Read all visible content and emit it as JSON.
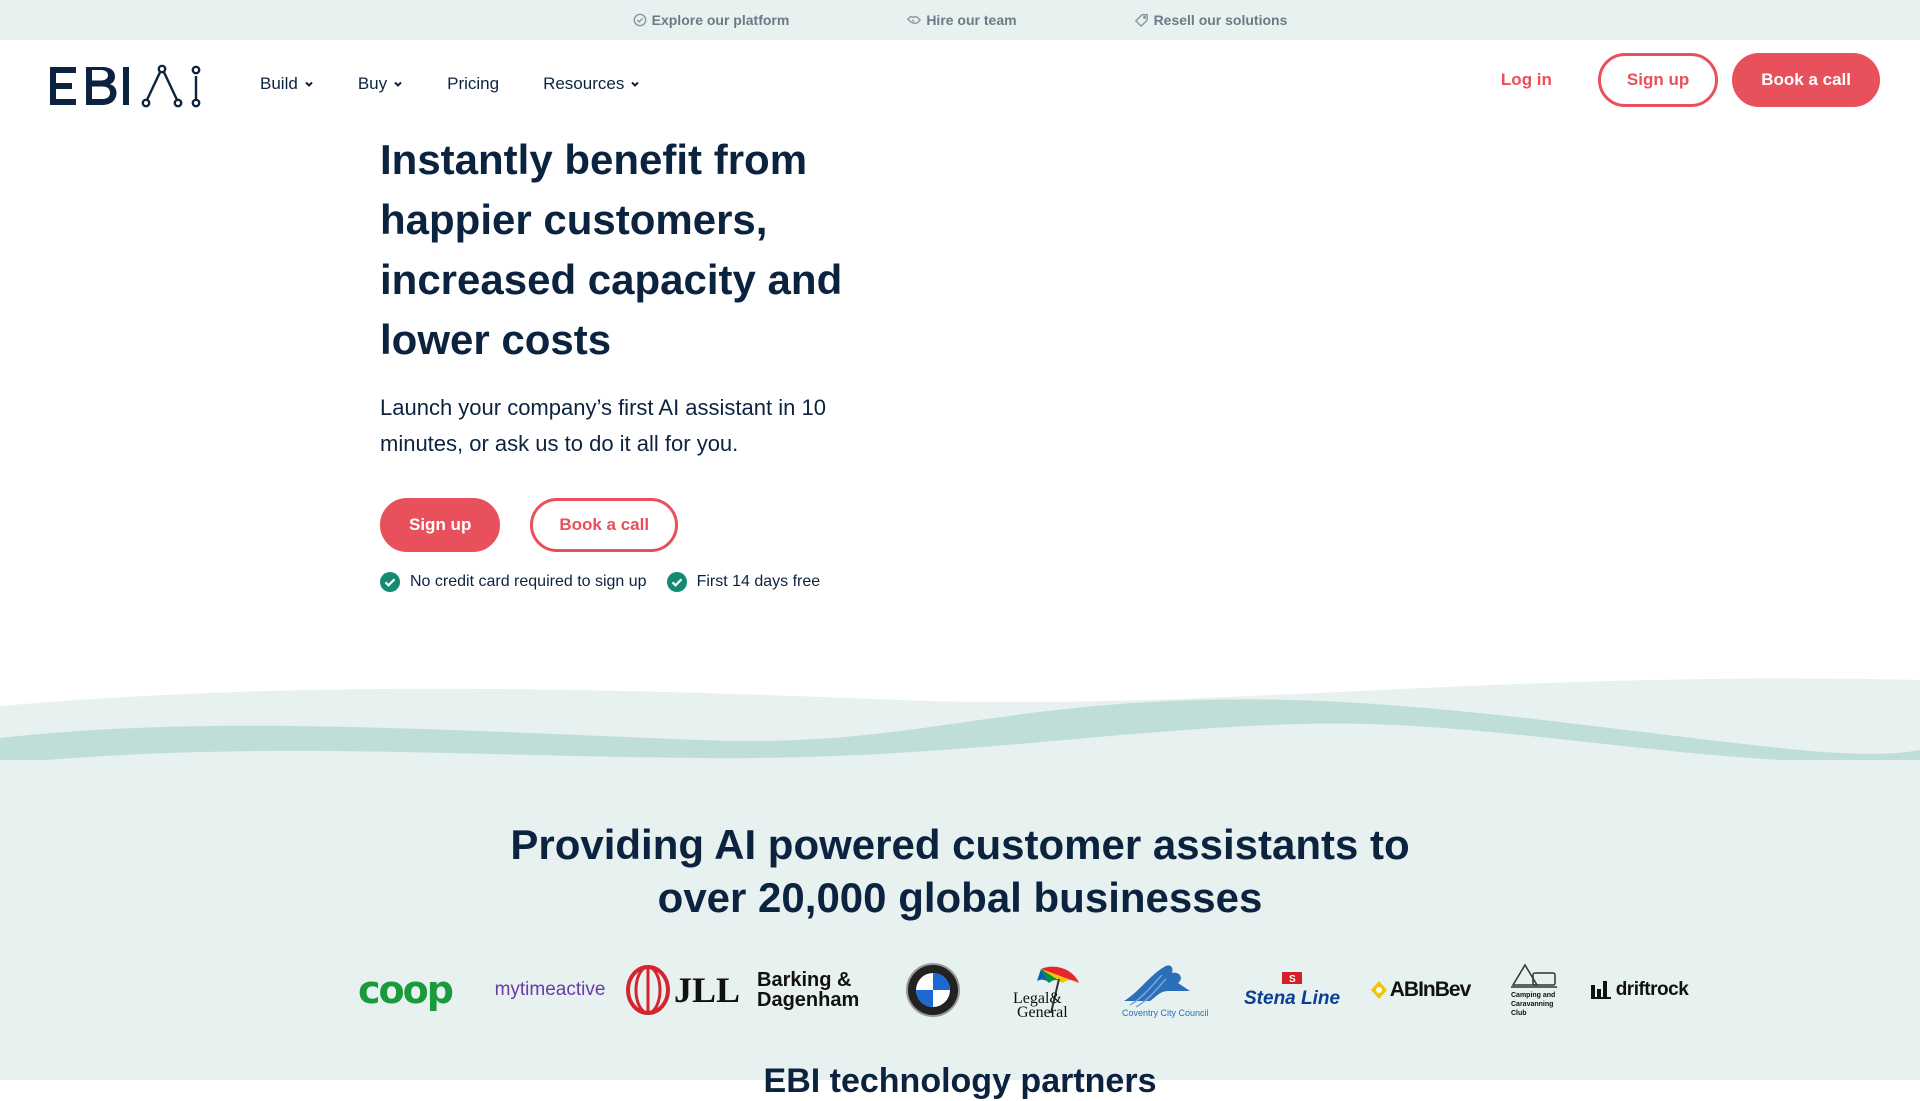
{
  "topbar": {
    "items": [
      {
        "label": "Explore our platform",
        "icon": "check-circle-icon"
      },
      {
        "label": "Hire our team",
        "icon": "handshake-icon"
      },
      {
        "label": "Resell our solutions",
        "icon": "tag-icon"
      }
    ]
  },
  "nav": {
    "logo": "EBI.AI",
    "menu": [
      {
        "label": "Build",
        "dropdown": true
      },
      {
        "label": "Buy",
        "dropdown": true
      },
      {
        "label": "Pricing",
        "dropdown": false
      },
      {
        "label": "Resources",
        "dropdown": true
      }
    ],
    "login_label": "Log in",
    "signup_label": "Sign up",
    "book_label": "Book a call"
  },
  "hero": {
    "title": "Instantly benefit from happier customers, increased capacity and lower costs",
    "subtitle": "Launch your company’s first AI assistant in 10 minutes, or ask us to do it all for you.",
    "signup_label": "Sign up",
    "book_label": "Book a call",
    "checks": [
      "No credit card required to sign up",
      "First 14 days free"
    ]
  },
  "clients": {
    "heading": "Providing AI powered customer assistants to over 20,000 global businesses",
    "logos": [
      "coop",
      "mytimeactive",
      "JLL",
      "Barking & Dagenham",
      "BMW",
      "Legal & General",
      "Coventry City Council",
      "Stena Line",
      "ABInBev",
      "Camping and Caravanning Club",
      "driftrock"
    ]
  },
  "partners": {
    "heading": "EBI technology partners"
  },
  "colors": {
    "brand_red": "#e8505b",
    "navy": "#0c2340",
    "mint_bg": "#e7f1ef",
    "wave": "#bfdeda",
    "check_green": "#138a72"
  }
}
